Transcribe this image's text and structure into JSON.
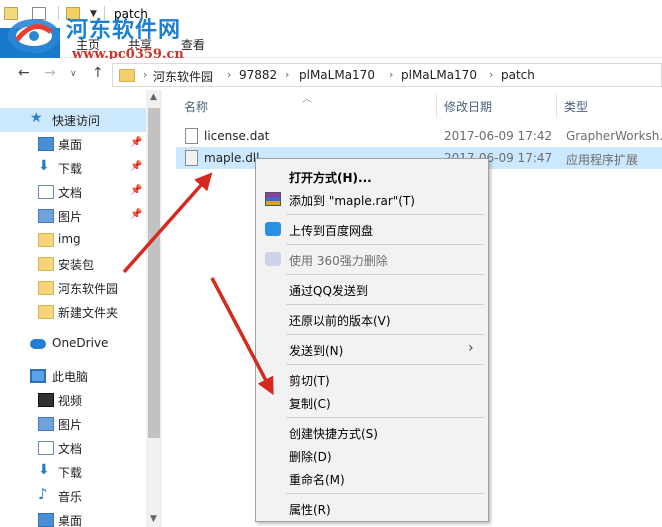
{
  "window": {
    "title": "patch"
  },
  "ribbon": {
    "tabs": [
      "主页",
      "共享",
      "查看"
    ]
  },
  "watermark": {
    "brand": "河东软件网",
    "url": "www.pc0359.cn"
  },
  "address": {
    "crumbs": [
      "河东软件园",
      "97882",
      "plMaLMa170",
      "plMaLMa170",
      "patch"
    ]
  },
  "sidebar": {
    "items": [
      {
        "label": "快速访问",
        "icon": "star-icon"
      },
      {
        "label": "桌面",
        "icon": "desktop-icon",
        "pinned": true
      },
      {
        "label": "下载",
        "icon": "download-icon",
        "pinned": true
      },
      {
        "label": "文档",
        "icon": "document-icon",
        "pinned": true
      },
      {
        "label": "图片",
        "icon": "picture-icon",
        "pinned": true
      },
      {
        "label": "img",
        "icon": "folder-icon"
      },
      {
        "label": "安装包",
        "icon": "folder-icon"
      },
      {
        "label": "河东软件园",
        "icon": "folder-icon"
      },
      {
        "label": "新建文件夹",
        "icon": "folder-icon"
      },
      {
        "label": "OneDrive",
        "icon": "cloud-icon"
      },
      {
        "label": "此电脑",
        "icon": "computer-icon"
      },
      {
        "label": "视频",
        "icon": "video-icon"
      },
      {
        "label": "图片",
        "icon": "picture-icon"
      },
      {
        "label": "文档",
        "icon": "document-icon"
      },
      {
        "label": "下载",
        "icon": "download-icon"
      },
      {
        "label": "音乐",
        "icon": "music-icon"
      },
      {
        "label": "桌面",
        "icon": "desktop-icon"
      }
    ]
  },
  "columns": {
    "name": "名称",
    "date": "修改日期",
    "type": "类型"
  },
  "files": [
    {
      "name": "license.dat",
      "date": "2017-06-09 17:42",
      "type": "GrapherWorksh..."
    },
    {
      "name": "maple.dll",
      "date": "2017-06-09 17:47",
      "type": "应用程序扩展"
    }
  ],
  "context_menu": {
    "open_with": "打开方式(H)...",
    "add_to_rar": "添加到 \"maple.rar\"(T)",
    "upload_baidu": "上传到百度网盘",
    "force_delete_360": "使用 360强力删除",
    "send_qq": "通过QQ发送到",
    "restore_previous": "还原以前的版本(V)",
    "send_to": "发送到(N)",
    "cut": "剪切(T)",
    "copy": "复制(C)",
    "create_shortcut": "创建快捷方式(S)",
    "delete": "删除(D)",
    "rename": "重命名(M)",
    "properties": "属性(R)"
  },
  "colors": {
    "selection": "#cce8ff",
    "accent": "#1979ca",
    "arrow": "#d42a1f"
  }
}
